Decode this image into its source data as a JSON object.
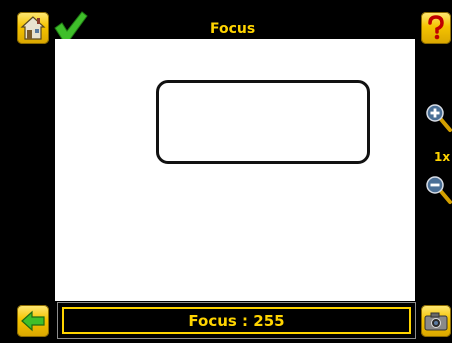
{
  "header": {
    "title": "Focus"
  },
  "toolbar": {
    "home_icon": "home-icon",
    "status_icon": "checkmark-icon",
    "help_icon": "question-mark-icon",
    "back_icon": "back-arrow-icon",
    "camera_icon": "camera-icon"
  },
  "zoom": {
    "in_icon": "zoom-in-icon",
    "level": "1x",
    "out_icon": "zoom-out-icon"
  },
  "status": {
    "text": "Focus : 255"
  },
  "colors": {
    "accent": "#ffd400",
    "background": "#000000",
    "viewport": "#ffffff",
    "check": "#3fbf2a"
  }
}
